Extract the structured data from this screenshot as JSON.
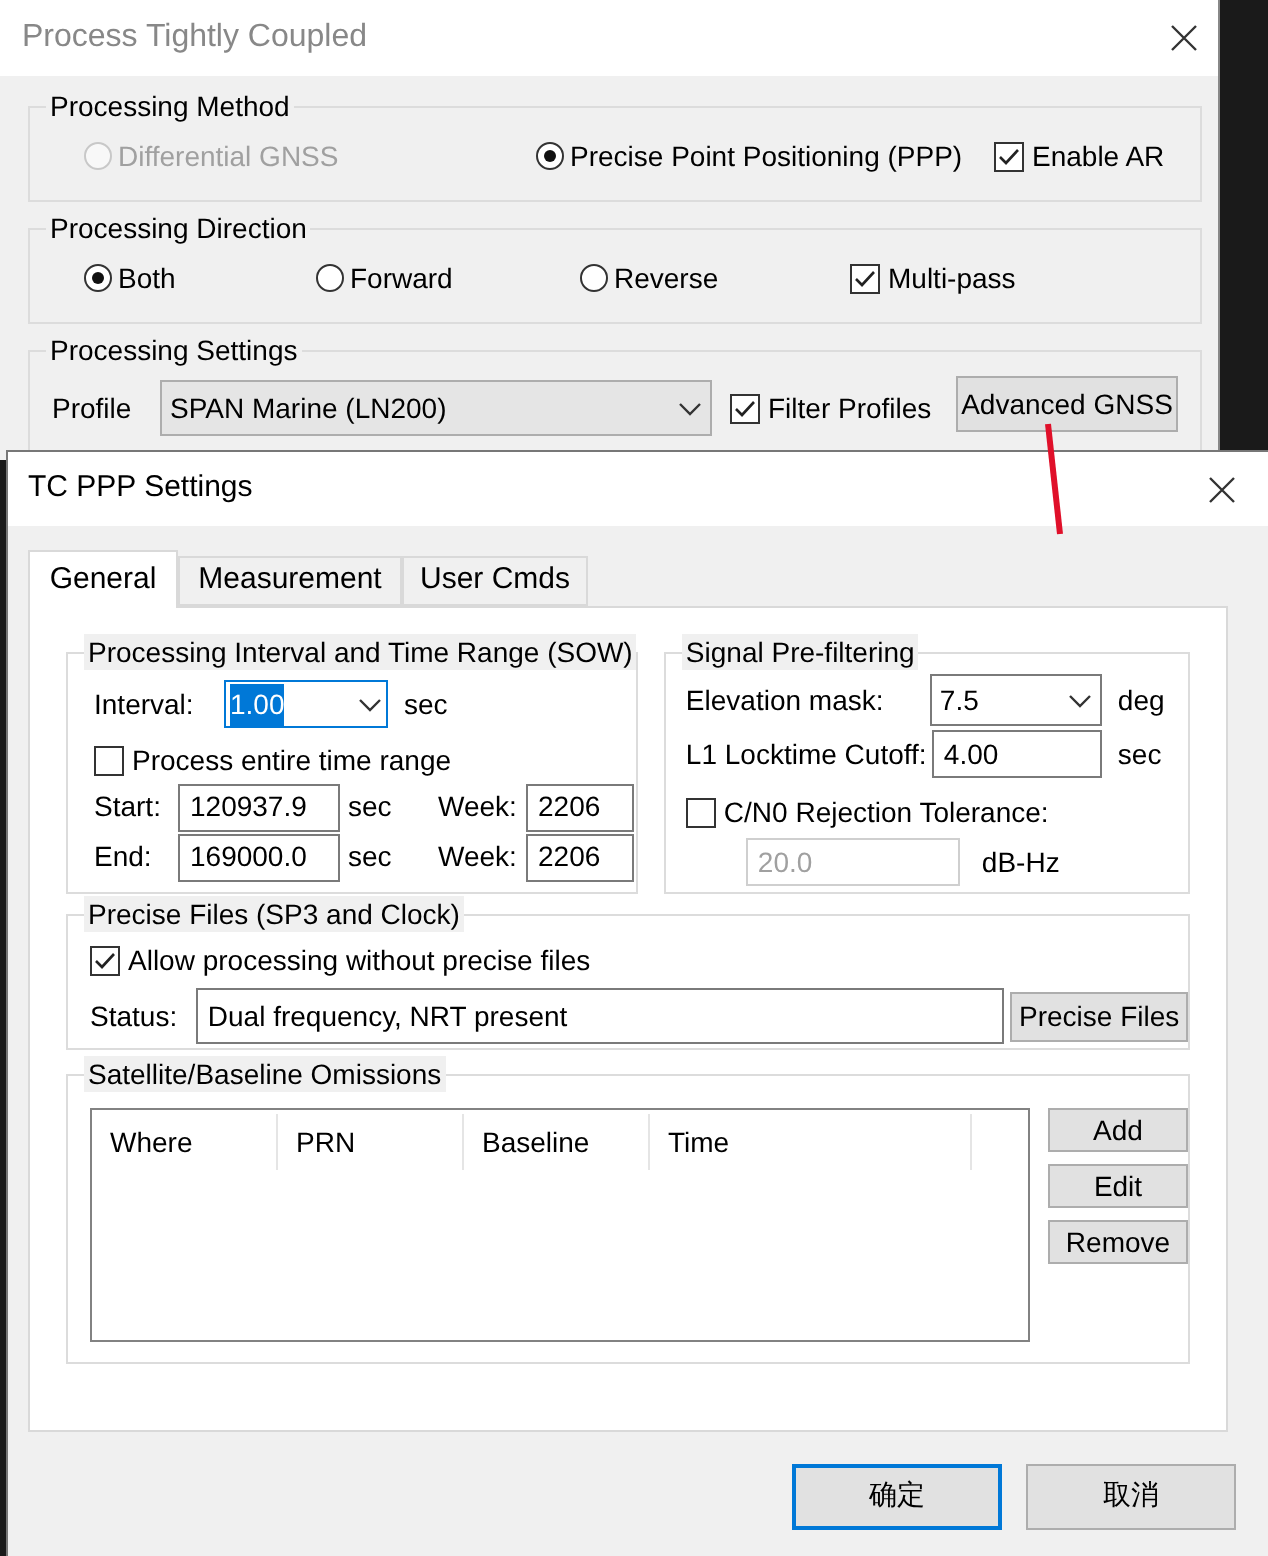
{
  "background_window": {
    "title": "Process Tightly Coupled",
    "processing_method": {
      "label": "Processing Method",
      "options": [
        {
          "label": "Differential GNSS",
          "selected": false,
          "disabled": true
        },
        {
          "label": "Precise Point Positioning (PPP)",
          "selected": true,
          "disabled": false
        }
      ],
      "enable_ar": {
        "label": "Enable AR",
        "checked": true
      }
    },
    "processing_direction": {
      "label": "Processing Direction",
      "options": [
        {
          "label": "Both",
          "selected": true,
          "disabled": false
        },
        {
          "label": "Forward",
          "selected": false,
          "disabled": false
        },
        {
          "label": "Reverse",
          "selected": false,
          "disabled": false
        }
      ],
      "multi_pass": {
        "label": "Multi-pass",
        "checked": true
      }
    },
    "processing_settings": {
      "label": "Processing Settings",
      "profile_label": "Profile",
      "profile": "SPAN Marine (LN200)",
      "filter_profiles": {
        "label": "Filter Profiles",
        "checked": true
      },
      "advanced_button": "Advanced GNSS"
    }
  },
  "dialog": {
    "title": "TC PPP Settings",
    "tabs": [
      {
        "label": "General",
        "selected": true
      },
      {
        "label": "Measurement",
        "selected": false
      },
      {
        "label": "User Cmds",
        "selected": false
      }
    ],
    "interval_group": {
      "label": "Processing Interval and Time Range (SOW)",
      "interval_label": "Interval:",
      "interval": {
        "value": "1.00",
        "focused": true
      },
      "interval_unit": "sec",
      "entire_range": {
        "label": "Process entire time range",
        "checked": false
      },
      "rows": [
        {
          "label": "Start:",
          "value": "120937.9",
          "unit": "sec",
          "week_label": "Week:",
          "week": "2206"
        },
        {
          "label": "End:",
          "value": "169000.0",
          "unit": "sec",
          "week_label": "Week:",
          "week": "2206"
        }
      ]
    },
    "signal_group": {
      "label": "Signal Pre-filtering",
      "elevation_label": "Elevation mask:",
      "elevation": "7.5",
      "elevation_unit": "deg",
      "locktime_label": "L1 Locktime Cutoff:",
      "locktime": "4.00",
      "locktime_unit": "sec",
      "cn0": {
        "label": "C/N0 Rejection Tolerance:",
        "checked": false
      },
      "cn0_value": {
        "value": "20.0",
        "disabled": true
      },
      "cn0_unit": "dB-Hz"
    },
    "precise_group": {
      "label": "Precise Files (SP3 and Clock)",
      "allow": {
        "label": "Allow processing without precise files",
        "checked": true
      },
      "status_label": "Status:",
      "status": "Dual frequency, NRT present",
      "button": "Precise Files"
    },
    "omissions_group": {
      "label": "Satellite/Baseline Omissions",
      "columns": [
        "Where",
        "PRN",
        "Baseline",
        "Time"
      ],
      "buttons": [
        "Add",
        "Edit",
        "Remove"
      ]
    },
    "buttons": [
      {
        "label": "确定",
        "default": true
      },
      {
        "label": "取消",
        "default": false
      }
    ]
  }
}
